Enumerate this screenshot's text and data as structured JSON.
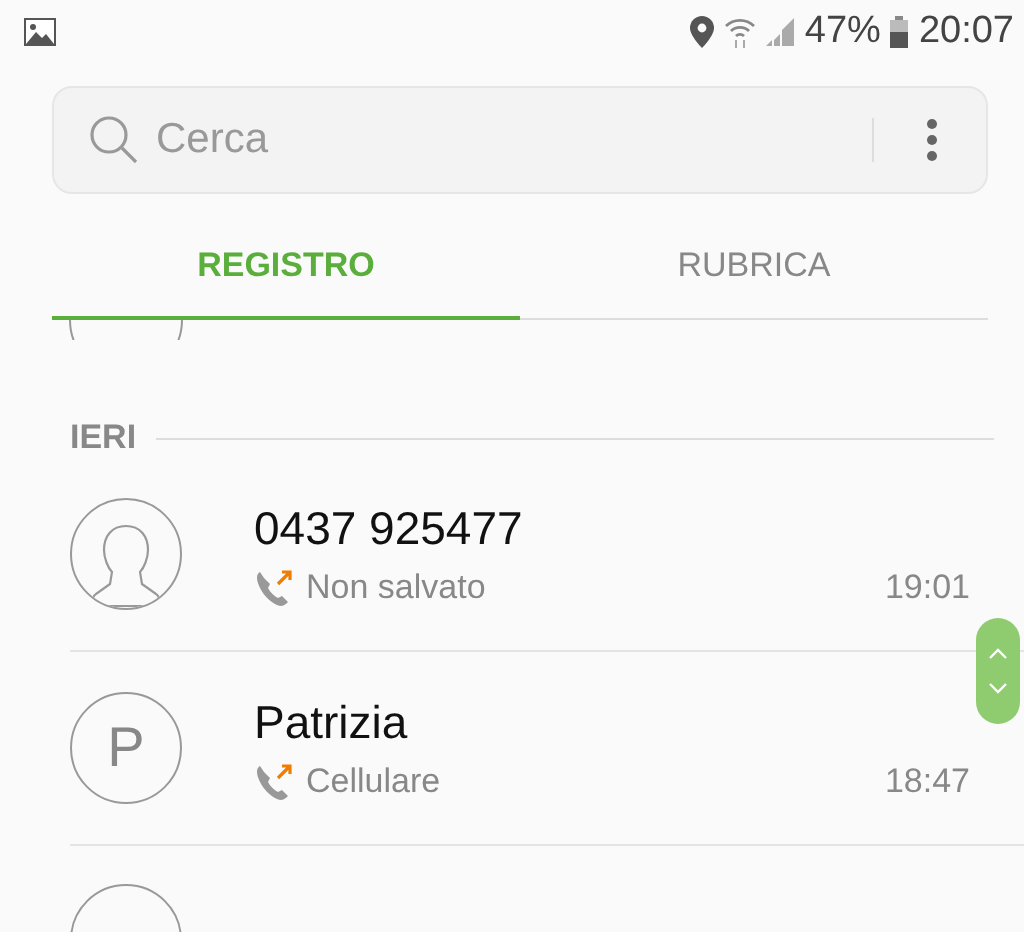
{
  "status_bar": {
    "battery_text": "47%",
    "time": "20:07"
  },
  "search": {
    "placeholder": "Cerca"
  },
  "tabs": [
    {
      "label": "REGISTRO",
      "selected": true
    },
    {
      "label": "RUBRICA",
      "selected": false
    }
  ],
  "section": "IERI",
  "calls": [
    {
      "avatar": {
        "kind": "silhouette"
      },
      "name": "0437 925477",
      "kind": "outgoing",
      "detail": "Non salvato",
      "time": "19:01"
    },
    {
      "avatar": {
        "kind": "letter",
        "letter": "P"
      },
      "name": "Patrizia",
      "kind": "outgoing",
      "detail": "Cellulare",
      "time": "18:47"
    }
  ]
}
